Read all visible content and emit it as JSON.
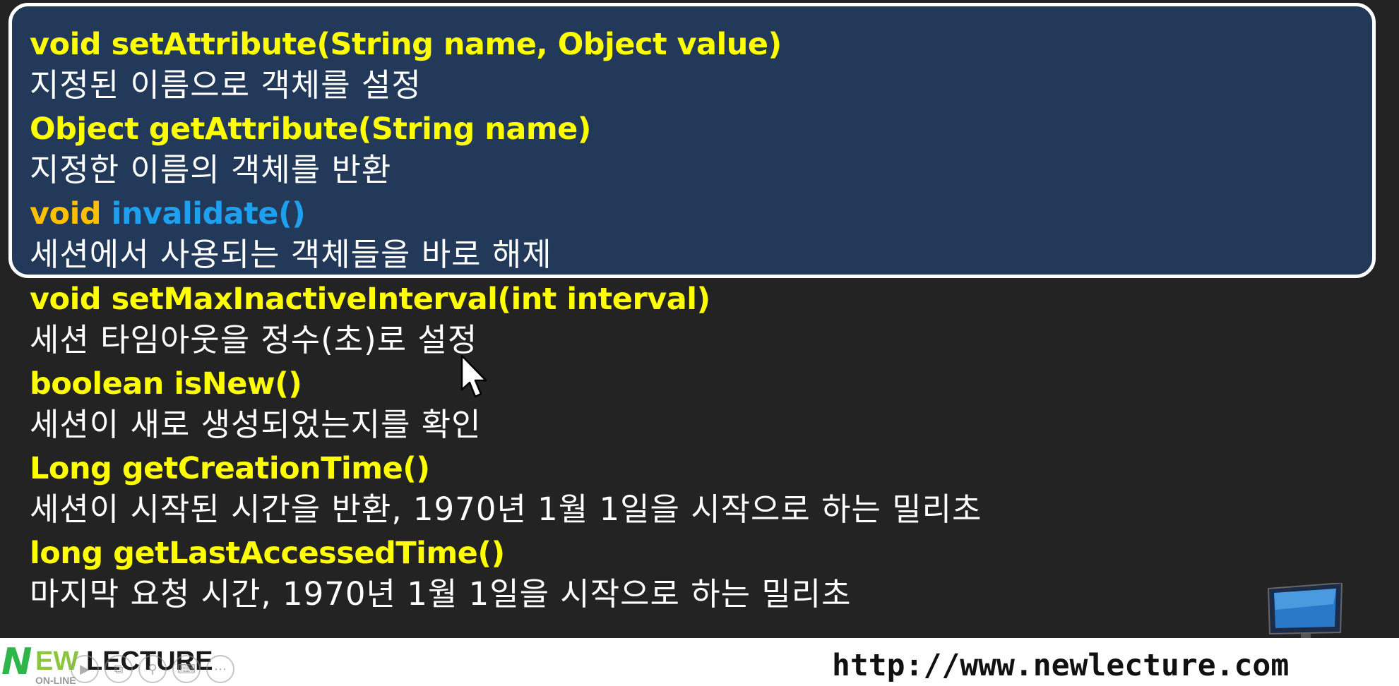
{
  "methods": [
    {
      "return_type": "void",
      "name": "setAttribute(String name, Object value)",
      "description": "지정된 이름으로 객체를 설정"
    },
    {
      "return_type": "Object",
      "name": "getAttribute(String name)",
      "description": "지정한 이름의 객체를 반환"
    },
    {
      "return_type": "void",
      "name": "invalidate()",
      "description": "세션에서 사용되는 객체들을 바로 해제"
    },
    {
      "return_type": "void",
      "name": "setMaxInactiveInterval(int interval)",
      "description": "세션 타임아웃을 정수(초)로 설정"
    },
    {
      "return_type": "boolean",
      "name": "isNew()",
      "description": "세션이 새로 생성되었는지를 확인"
    },
    {
      "return_type": "Long",
      "name": "getCreationTime()",
      "description": "세션이 시작된 시간을 반환, 1970년 1월 1일을 시작으로 하는 밀리초"
    },
    {
      "return_type": "long",
      "name": "getLastAccessedTime()",
      "description": "마지막 요청 시간, 1970년 1월 1일을 시작으로 하는 밀리초"
    }
  ],
  "footer": {
    "logo_letter": "N",
    "logo_text_1": "EW",
    "logo_text_2": "LECTURE",
    "logo_sub": "ON-LINE",
    "url": "http://www.newlecture.com"
  },
  "colors": {
    "background": "#232323",
    "highlight_box": "#22395a",
    "signature": "#ffff00",
    "highlighted_return_type": "#ffc000",
    "highlighted_method": "#1fa0ee",
    "description": "#ffffff"
  },
  "icons": {
    "cursor": "mouse-pointer-icon",
    "computer": "computer-workstation-icon",
    "player_controls": [
      "play-icon",
      "copy-icon",
      "search-icon",
      "keyboard-icon",
      "more-icon"
    ]
  }
}
